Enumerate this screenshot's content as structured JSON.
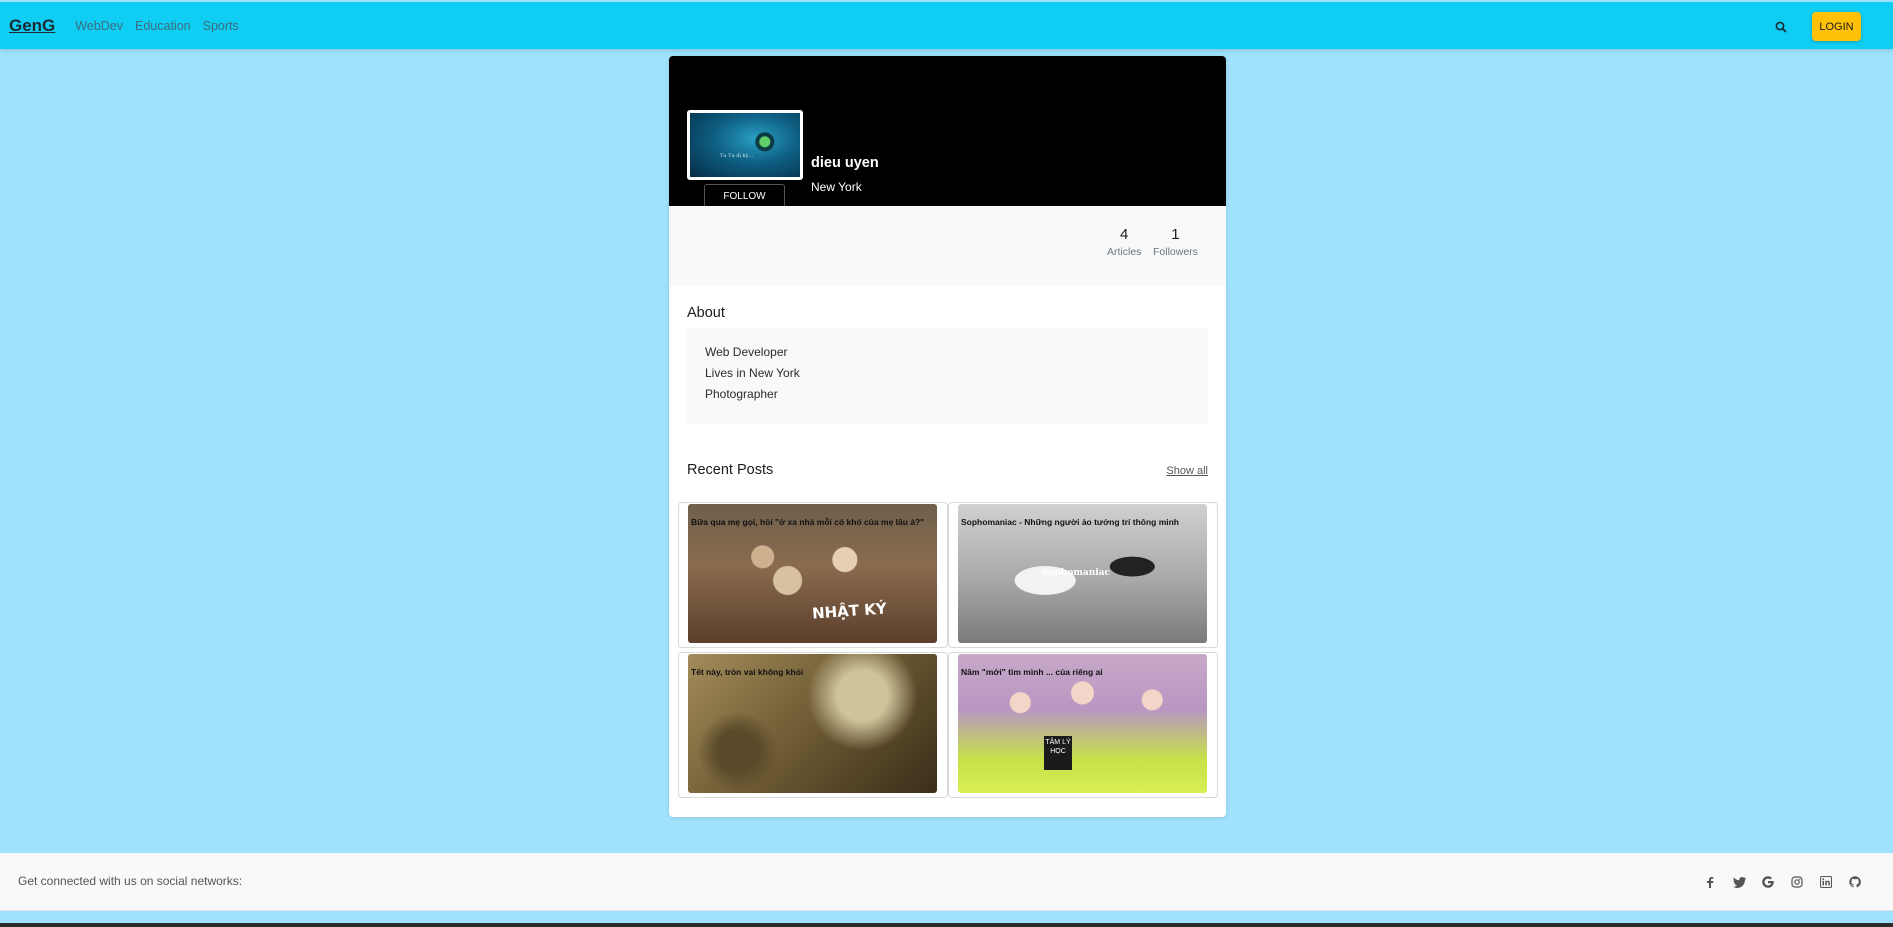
{
  "nav": {
    "brand": "GenG",
    "links": [
      "WebDev",
      "Education",
      "Sports"
    ],
    "login_label": "LOGIN",
    "search_icon": "search-icon"
  },
  "profile": {
    "name": "dieu uyen",
    "location": "New York",
    "follow_label": "FOLLOW",
    "avatar_text": "Tu Tu dị kỳ...",
    "stats": [
      {
        "value": "4",
        "label": "Articles"
      },
      {
        "value": "1",
        "label": "Followers"
      }
    ]
  },
  "about": {
    "title": "About",
    "lines": [
      "Web Developer",
      "Lives in New York",
      "Photographer"
    ]
  },
  "recent": {
    "title": "Recent Posts",
    "show_all": "Show all",
    "posts": [
      {
        "title": "Bữa qua mẹ gọi, hỏi \"ở xa nhà mỗi có khó của mẹ lâu à?\"",
        "overlay": "NHẬT KÝ"
      },
      {
        "title": "Sophomaniac - Những người ảo tưởng trí thông minh",
        "overlay": "Sophomaniac"
      },
      {
        "title": "Tết này, tròn vai không khỏi",
        "overlay": ""
      },
      {
        "title": "Năm \"mới\" tìm mình ... của riêng ai",
        "overlay": "TÂM LÝ HỌC"
      }
    ]
  },
  "footer": {
    "text": "Get connected with us on social networks:",
    "socials": [
      "facebook-icon",
      "twitter-icon",
      "google-icon",
      "instagram-icon",
      "linkedin-icon",
      "github-icon"
    ]
  },
  "colors": {
    "page_bg": "#a0e2fd",
    "navbar": "#10cdf3",
    "login_button": "#ffc107",
    "cover": "#000000"
  }
}
